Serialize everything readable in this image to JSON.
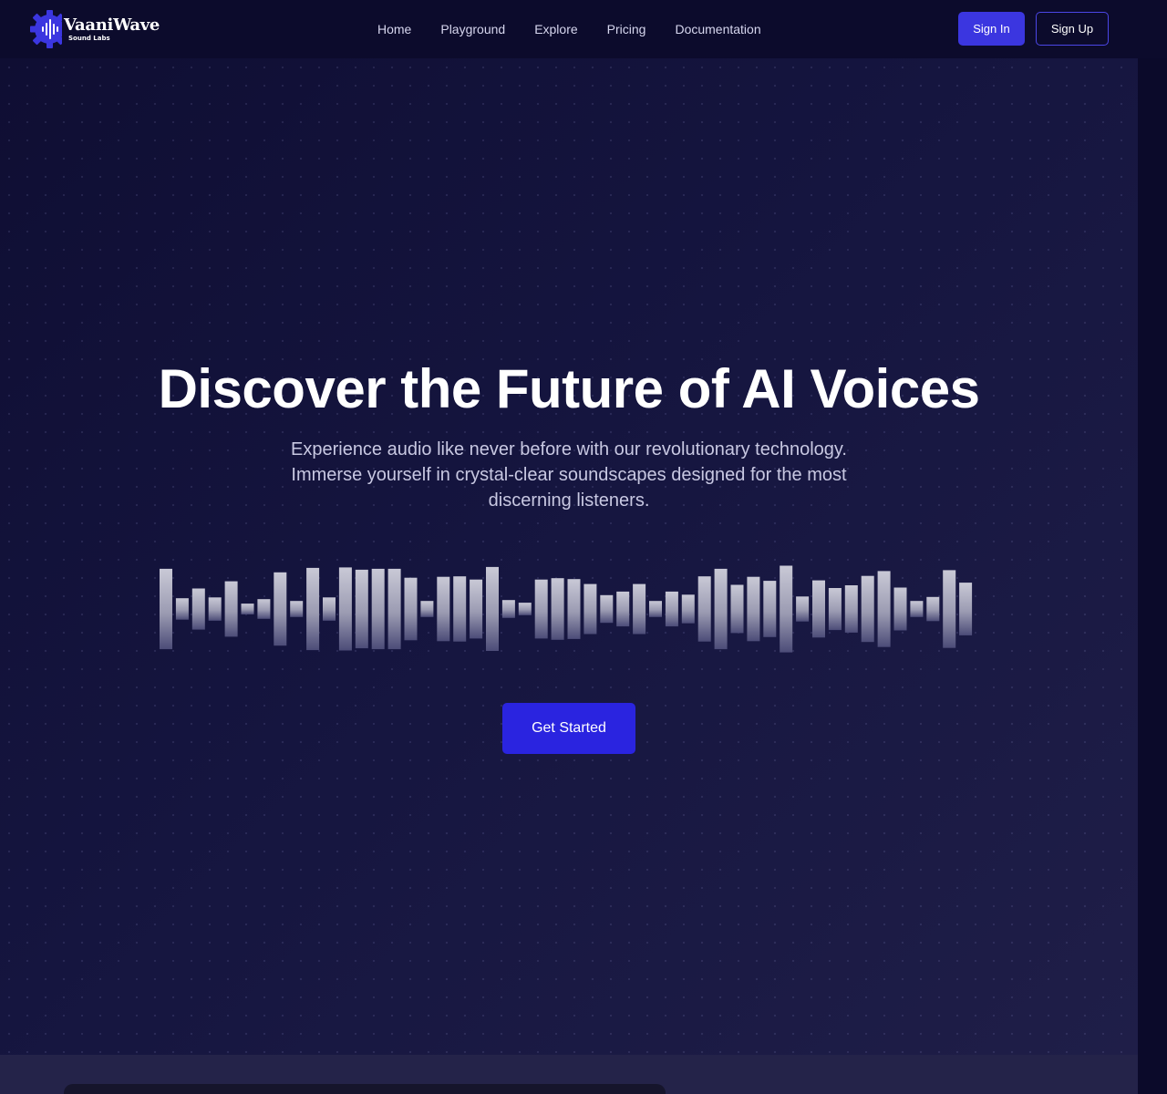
{
  "brand": {
    "name": "VaaniWave",
    "tagline": "Sound Labs",
    "logo_icon": "gear-soundwave-icon",
    "accent_color": "#3b36e0"
  },
  "nav": {
    "links": [
      "Home",
      "Playground",
      "Explore",
      "Pricing",
      "Documentation"
    ],
    "sign_in": "Sign In",
    "sign_up": "Sign Up"
  },
  "hero": {
    "title": "Discover the Future of AI Voices",
    "subtitle": "Experience audio like never before with our revolutionary technology. Immerse yourself in crystal-clear soundscapes designed for the most discerning listeners.",
    "cta": "Get Started",
    "waveform_icon": "audio-waveform",
    "waveform_levels": [
      0.9,
      0.24,
      0.46,
      0.26,
      0.62,
      0.12,
      0.22,
      0.82,
      0.18,
      0.92,
      0.26,
      0.93,
      0.88,
      0.9,
      0.9,
      0.7,
      0.18,
      0.72,
      0.73,
      0.66,
      0.94,
      0.2,
      0.14,
      0.66,
      0.69,
      0.67,
      0.56,
      0.31,
      0.39,
      0.56,
      0.18,
      0.39,
      0.32,
      0.73,
      0.9,
      0.54,
      0.72,
      0.63,
      0.97,
      0.28,
      0.64,
      0.47,
      0.53,
      0.74,
      0.85,
      0.48,
      0.18,
      0.27,
      0.87,
      0.59
    ]
  }
}
